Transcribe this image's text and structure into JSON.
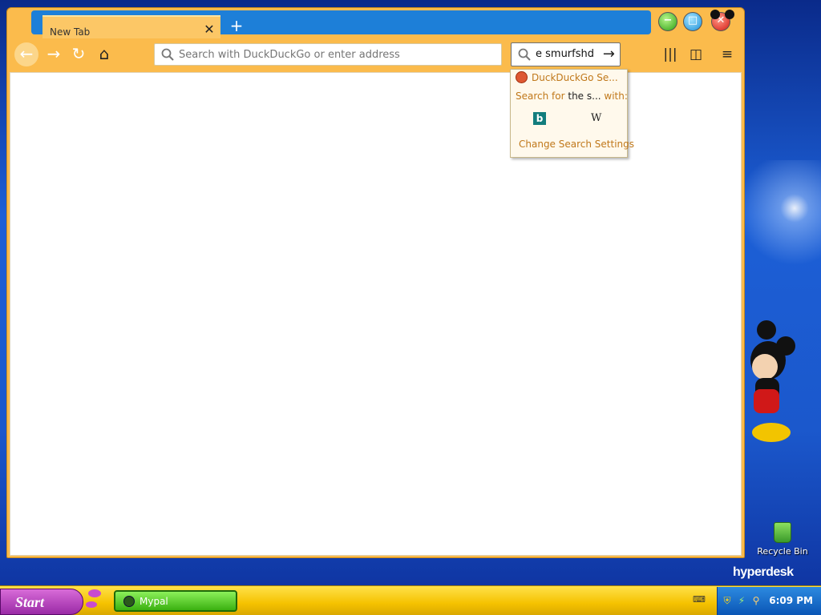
{
  "desktop": {
    "recycle_bin_label": "Recycle Bin",
    "brand_text": "hyperdesk"
  },
  "browser": {
    "tab": {
      "title": "New Tab",
      "close_symbol": "✕"
    },
    "new_tab_symbol": "+",
    "window_buttons": [
      "minimize",
      "maximize",
      "close"
    ],
    "toolbar": {
      "back_icon": "←",
      "forward_icon": "→",
      "reload_icon": "↻",
      "home_icon": "⌂",
      "url_placeholder": "Search with DuckDuckGo or enter address",
      "search_value": "e smurfshd",
      "go_icon": "→",
      "library_icon": "|||",
      "sidebar_icon": "◫",
      "menu_icon": "≡"
    },
    "search_popup": {
      "engine": "DuckDuckGo Se...",
      "search_for_prefix": "Search for",
      "search_for_query": "the s...",
      "search_for_suffix": "with:",
      "alt_engines": [
        "bing",
        "wikipedia"
      ],
      "bing_glyph": "b",
      "wiki_glyph": "W",
      "settings_label": "Change Search Settings"
    }
  },
  "taskbar": {
    "start_label": "Start",
    "apps": [
      {
        "label": "Mypal"
      }
    ],
    "tray_icons": [
      "shield-icon",
      "network-icon",
      "search-icon"
    ],
    "clock": "6:09 PM"
  },
  "colors": {
    "window_orange": "#fbbb4c",
    "tab_strip_blue": "#1d7fd8",
    "taskbar_yellow": "#f5c200",
    "start_purple": "#9a2aa6",
    "app_green": "#3ab010",
    "popup_link": "#c0781a"
  }
}
